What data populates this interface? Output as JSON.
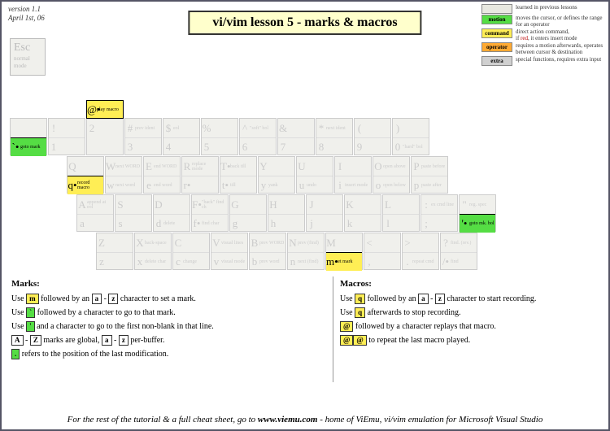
{
  "version": {
    "line1": "version 1.1",
    "line2": "April 1st, 06"
  },
  "title": "vi/vim lesson 5 - marks & macros",
  "legend": {
    "prev": "learned in previous lessons",
    "motion_label": "motion",
    "motion": "moves the cursor, or defines the range for an operator",
    "command_label": "command",
    "command_text": "direct action command,\nif red, it enters insert mode",
    "operator_label": "operator",
    "operator": "requires a motion afterwards, operates between cursor & destination",
    "extra_label": "extra",
    "extra": "special functions, requires extra input"
  },
  "esc": {
    "main": "Esc",
    "sub1": "normal",
    "sub2": "mode"
  },
  "row1": [
    {
      "upTxt": "",
      "upLbl": "",
      "lowTxt": "`•",
      "lowLbl": "goto mark",
      "lowClass": "hl-motion"
    },
    {
      "upTxt": "!",
      "upLbl": "",
      "lowTxt": "1",
      "lowLbl": ""
    },
    {
      "upTxt": "@•",
      "upLbl": "play macro",
      "lowTxt": "2",
      "lowLbl": "",
      "upClass": "hl-command"
    },
    {
      "upTxt": "#",
      "upLbl": "prev ident",
      "lowTxt": "3",
      "lowLbl": ""
    },
    {
      "upTxt": "$",
      "upLbl": "eol",
      "lowTxt": "4",
      "lowLbl": ""
    },
    {
      "upTxt": "%",
      "upLbl": "",
      "lowTxt": "5",
      "lowLbl": ""
    },
    {
      "upTxt": "^",
      "upLbl": "\"soft\" bol",
      "lowTxt": "6",
      "lowLbl": ""
    },
    {
      "upTxt": "&",
      "upLbl": "",
      "lowTxt": "7",
      "lowLbl": ""
    },
    {
      "upTxt": "*",
      "upLbl": "next ident",
      "lowTxt": "8",
      "lowLbl": ""
    },
    {
      "upTxt": "(",
      "upLbl": "",
      "lowTxt": "9",
      "lowLbl": ""
    },
    {
      "upTxt": ")",
      "upLbl": "",
      "lowTxt": "0",
      "lowLbl": "\"hard\" bol"
    }
  ],
  "row2": [
    {
      "upTxt": "Q",
      "upLbl": "",
      "lowTxt": "q•",
      "lowLbl": "record macro",
      "lowClass": "hl-command"
    },
    {
      "upTxt": "W",
      "upLbl": "next WORD",
      "lowTxt": "w",
      "lowLbl": "next word"
    },
    {
      "upTxt": "E",
      "upLbl": "end WORD",
      "lowTxt": "e",
      "lowLbl": "end word"
    },
    {
      "upTxt": "R",
      "upLbl": "replace mode",
      "lowTxt": "r•",
      "lowLbl": ""
    },
    {
      "upTxt": "T•",
      "upLbl": "back till",
      "lowTxt": "t•",
      "lowLbl": "till"
    },
    {
      "upTxt": "Y",
      "upLbl": "",
      "lowTxt": "y",
      "lowLbl": "yank"
    },
    {
      "upTxt": "U",
      "upLbl": "",
      "lowTxt": "u",
      "lowLbl": "undo"
    },
    {
      "upTxt": "I",
      "upLbl": "",
      "lowTxt": "i",
      "lowLbl": "insert mode"
    },
    {
      "upTxt": "O",
      "upLbl": "open above",
      "lowTxt": "o",
      "lowLbl": "open below"
    },
    {
      "upTxt": "P",
      "upLbl": "paste before",
      "lowTxt": "p",
      "lowLbl": "paste after"
    }
  ],
  "row3": [
    {
      "upTxt": "A",
      "upLbl": "append at eol",
      "lowTxt": "a",
      "lowLbl": ""
    },
    {
      "upTxt": "S",
      "upLbl": "",
      "lowTxt": "s",
      "lowLbl": ""
    },
    {
      "upTxt": "D",
      "upLbl": "",
      "lowTxt": "d",
      "lowLbl": "delete"
    },
    {
      "upTxt": "F•",
      "upLbl": "\"back\" find ch",
      "lowTxt": "f•",
      "lowLbl": "find char"
    },
    {
      "upTxt": "G",
      "upLbl": "",
      "lowTxt": "g",
      "lowLbl": ""
    },
    {
      "upTxt": "H",
      "upLbl": "",
      "lowTxt": "h",
      "lowLbl": ""
    },
    {
      "upTxt": "J",
      "upLbl": "",
      "lowTxt": "j",
      "lowLbl": ""
    },
    {
      "upTxt": "K",
      "upLbl": "",
      "lowTxt": "k",
      "lowLbl": ""
    },
    {
      "upTxt": "L",
      "upLbl": "",
      "lowTxt": "l",
      "lowLbl": ""
    },
    {
      "upTxt": ":",
      "upLbl": "ex cmd line",
      "lowTxt": ";",
      "lowLbl": ""
    },
    {
      "upTxt": "\"",
      "upLbl": "reg. spec",
      "lowTxt": "'•",
      "lowLbl": "goto mk. bol",
      "lowClass": "hl-motion"
    }
  ],
  "row4": [
    {
      "upTxt": "Z",
      "upLbl": "",
      "lowTxt": "z",
      "lowLbl": ""
    },
    {
      "upTxt": "X",
      "upLbl": "back-space",
      "lowTxt": "x",
      "lowLbl": "delete char"
    },
    {
      "upTxt": "C",
      "upLbl": "",
      "lowTxt": "c",
      "lowLbl": "change"
    },
    {
      "upTxt": "V",
      "upLbl": "visual lines",
      "lowTxt": "v",
      "lowLbl": "visual mode"
    },
    {
      "upTxt": "B",
      "upLbl": "prev WORD",
      "lowTxt": "b",
      "lowLbl": "prev word"
    },
    {
      "upTxt": "N",
      "upLbl": "prev (find)",
      "lowTxt": "n",
      "lowLbl": "next (find)"
    },
    {
      "upTxt": "M",
      "upLbl": "",
      "lowTxt": "m•",
      "lowLbl": "set mark",
      "lowClass": "hl-command"
    },
    {
      "upTxt": "<",
      "upLbl": "",
      "lowTxt": ",",
      "lowLbl": ""
    },
    {
      "upTxt": ">",
      "upLbl": "",
      "lowTxt": ".",
      "lowLbl": "repeat cmd"
    },
    {
      "upTxt": "?",
      "upLbl": "find. (rev.)",
      "lowTxt": "/•",
      "lowLbl": "find"
    }
  ],
  "marks": {
    "header": "Marks:",
    "l1a": "Use ",
    "l1b": " followed by an ",
    "l1c": " - ",
    "l1d": " character to set a mark.",
    "l2a": "Use ",
    "l2b": " followed by a character to go to that mark.",
    "l3a": "Use ",
    "l3b": " and a character to go to the first non-blank in that line.",
    "l4a": " - ",
    "l4b": " marks are global, ",
    "l4c": " - ",
    "l4d": " per-buffer.",
    "l5a": " refers to the position of the last modification."
  },
  "macros": {
    "header": "Macros:",
    "l1a": "Use ",
    "l1b": " followed by an ",
    "l1c": " - ",
    "l1d": " character to start recording.",
    "l2a": "Use ",
    "l2b": " afterwards to stop recording.",
    "l3a": " followed by a character replays that macro.",
    "l4a": " to repeat the last macro played."
  },
  "chips": {
    "m": "m",
    "q": "q",
    "a": "a",
    "z": "z",
    "A": "A",
    "Z": "Z",
    "tick": "`",
    "apos": "'",
    "at": "@",
    "atat": "@",
    "dot": "."
  },
  "footer": {
    "a": "For the rest of the tutorial & a full cheat sheet, go to ",
    "url": "www.viemu.com",
    "b": " - home of ViEmu, vi/vim emulation for Microsoft Visual Studio"
  }
}
